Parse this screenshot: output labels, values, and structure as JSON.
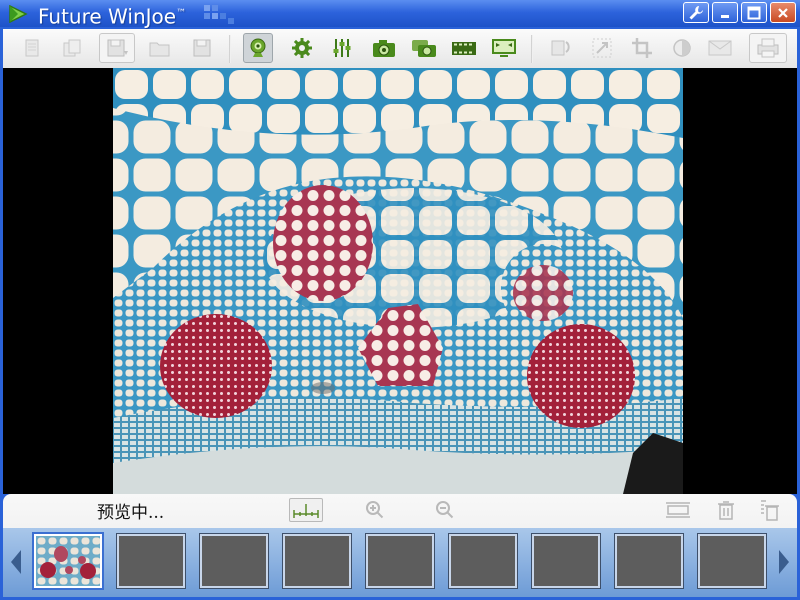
{
  "window": {
    "title": "Future WinJoe",
    "title_mark": "™"
  },
  "toolbar": {
    "buttons": [
      {
        "name": "new-icon",
        "enabled": false
      },
      {
        "name": "copy-icon",
        "enabled": false
      },
      {
        "name": "save-as-icon",
        "enabled": false
      },
      {
        "name": "open-folder-icon",
        "enabled": false
      },
      {
        "name": "save-icon",
        "enabled": false
      },
      {
        "name": "webcam-icon",
        "enabled": true,
        "active": true
      },
      {
        "name": "settings-gear-icon",
        "enabled": true
      },
      {
        "name": "adjust-sliders-icon",
        "enabled": true
      },
      {
        "name": "camera-capture-icon",
        "enabled": true
      },
      {
        "name": "multi-capture-icon",
        "enabled": true
      },
      {
        "name": "video-record-icon",
        "enabled": true
      },
      {
        "name": "fullscreen-display-icon",
        "enabled": true
      },
      {
        "name": "rotate-icon",
        "enabled": false
      },
      {
        "name": "resize-icon",
        "enabled": false
      },
      {
        "name": "crop-icon",
        "enabled": false
      },
      {
        "name": "contrast-icon",
        "enabled": false
      },
      {
        "name": "email-icon",
        "enabled": false
      },
      {
        "name": "print-icon",
        "enabled": false
      }
    ]
  },
  "viewer": {
    "status_text": "预览中..."
  },
  "colors": {
    "title_bar": "#2d63dc",
    "accent": "#3b6fd1",
    "icon_green": "#4a8a1c",
    "stain_red": "#a3213a",
    "stain_blue": "#4fa3c7"
  },
  "thumbnails": [
    {
      "selected": true,
      "has_image": true
    },
    {
      "selected": false,
      "has_image": false
    },
    {
      "selected": false,
      "has_image": false
    },
    {
      "selected": false,
      "has_image": false
    },
    {
      "selected": false,
      "has_image": false
    },
    {
      "selected": false,
      "has_image": false
    },
    {
      "selected": false,
      "has_image": false
    },
    {
      "selected": false,
      "has_image": false
    },
    {
      "selected": false,
      "has_image": false
    }
  ]
}
